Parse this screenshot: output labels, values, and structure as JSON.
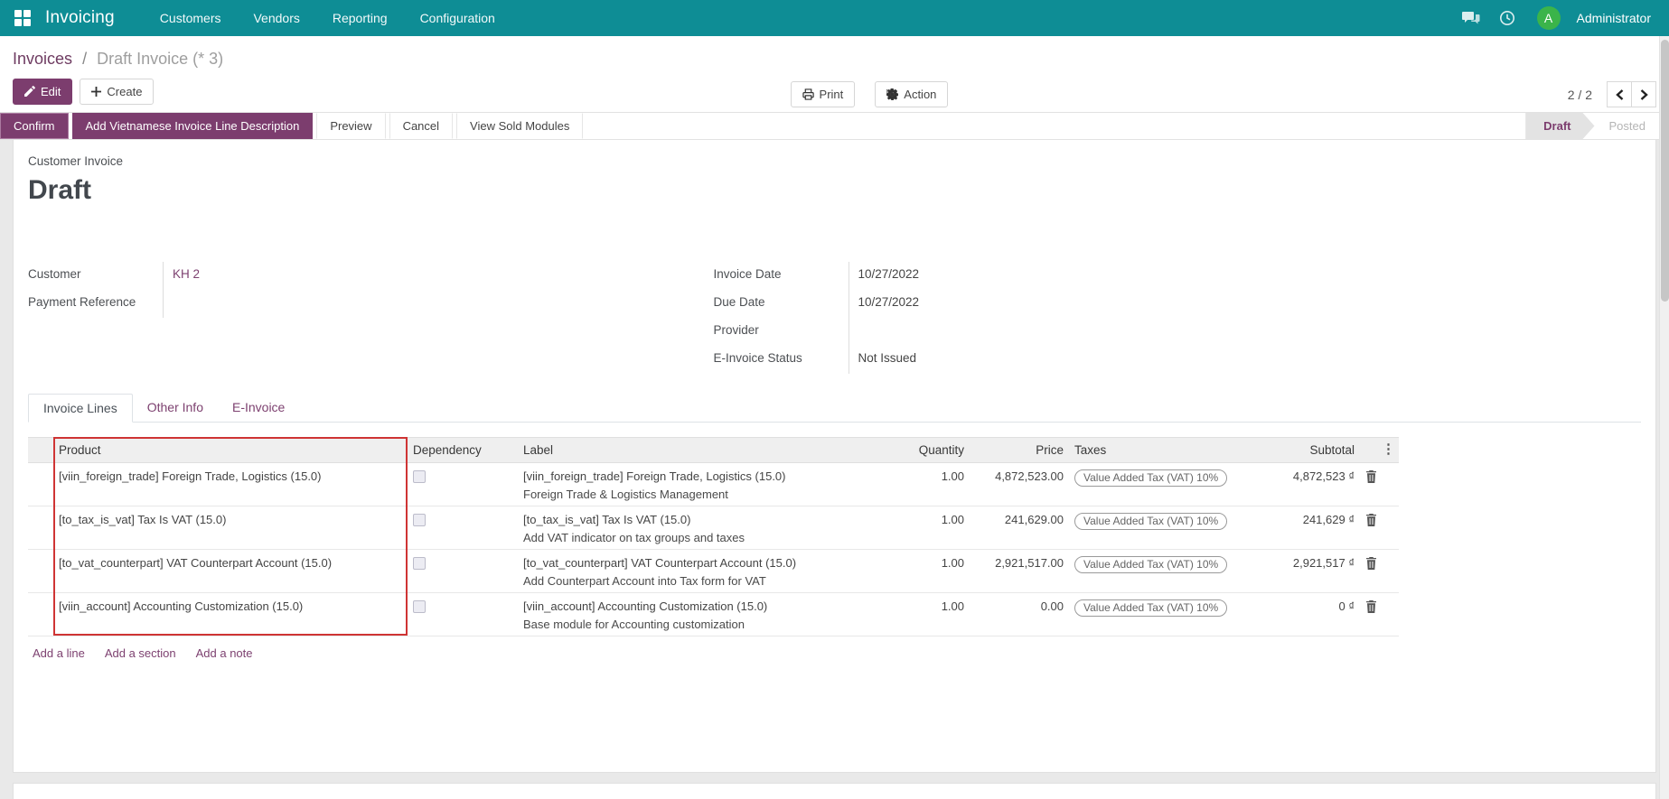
{
  "colors": {
    "navbar_teal": "#0e8d95",
    "primary_purple": "#7c3d6e",
    "link_purple": "#7d4170",
    "annotation_red": "#cf3434",
    "avatar_green": "#3bb44a"
  },
  "navbar": {
    "app_name": "Invoicing",
    "items": [
      {
        "label": "Customers"
      },
      {
        "label": "Vendors"
      },
      {
        "label": "Reporting"
      },
      {
        "label": "Configuration"
      }
    ],
    "avatar_letter": "A",
    "user": "Administrator"
  },
  "breadcrumb": {
    "parent": "Invoices",
    "separator": "/",
    "current": "Draft Invoice (* 3)"
  },
  "control": {
    "edit": "Edit",
    "create": "Create",
    "print": "Print",
    "action": "Action",
    "pager": "2 / 2"
  },
  "statusbar": {
    "confirm": "Confirm",
    "add_vn": "Add Vietnamese Invoice Line Description",
    "preview": "Preview",
    "cancel": "Cancel",
    "view_sold": "View Sold Modules",
    "state_draft": "Draft",
    "state_posted": "Posted"
  },
  "doc": {
    "type_label": "Customer Invoice",
    "title": "Draft"
  },
  "fields": {
    "customer_label": "Customer",
    "customer_value": "KH 2",
    "payment_ref_label": "Payment Reference",
    "payment_ref_value": "",
    "invoice_date_label": "Invoice Date",
    "invoice_date_value": "10/27/2022",
    "due_date_label": "Due Date",
    "due_date_value": "10/27/2022",
    "provider_label": "Provider",
    "provider_value": "",
    "einvoice_status_label": "E-Invoice Status",
    "einvoice_status_value": "Not Issued"
  },
  "tabs": {
    "invoice_lines": "Invoice Lines",
    "other_info": "Other Info",
    "einvoice": "E-Invoice"
  },
  "table": {
    "headers": {
      "product": "Product",
      "dependency": "Dependency",
      "label": "Label",
      "quantity": "Quantity",
      "price": "Price",
      "taxes": "Taxes",
      "subtotal": "Subtotal",
      "kebab": "⋮"
    },
    "rows": [
      {
        "product": "[viin_foreign_trade] Foreign Trade, Logistics (15.0)",
        "label": "[viin_foreign_trade] Foreign Trade, Logistics (15.0)",
        "description": "Foreign Trade & Logistics Management",
        "quantity": "1.00",
        "price": "4,872,523.00",
        "tax": "Value Added Tax (VAT) 10%",
        "subtotal": "4,872,523 ₫"
      },
      {
        "product": "[to_tax_is_vat] Tax Is VAT (15.0)",
        "label": "[to_tax_is_vat] Tax Is VAT (15.0)",
        "description": "Add VAT indicator on tax groups and taxes",
        "quantity": "1.00",
        "price": "241,629.00",
        "tax": "Value Added Tax (VAT) 10%",
        "subtotal": "241,629 ₫"
      },
      {
        "product": "[to_vat_counterpart] VAT Counterpart Account (15.0)",
        "label": "[to_vat_counterpart] VAT Counterpart Account (15.0)",
        "description": "Add Counterpart Account into Tax form for VAT",
        "quantity": "1.00",
        "price": "2,921,517.00",
        "tax": "Value Added Tax (VAT) 10%",
        "subtotal": "2,921,517 ₫"
      },
      {
        "product": "[viin_account] Accounting Customization (15.0)",
        "label": "[viin_account] Accounting Customization (15.0)",
        "description": "Base module for Accounting customization",
        "quantity": "1.00",
        "price": "0.00",
        "tax": "Value Added Tax (VAT) 10%",
        "subtotal": "0 ₫"
      }
    ],
    "footer_links": {
      "add_line": "Add a line",
      "add_section": "Add a section",
      "add_note": "Add a note"
    }
  }
}
